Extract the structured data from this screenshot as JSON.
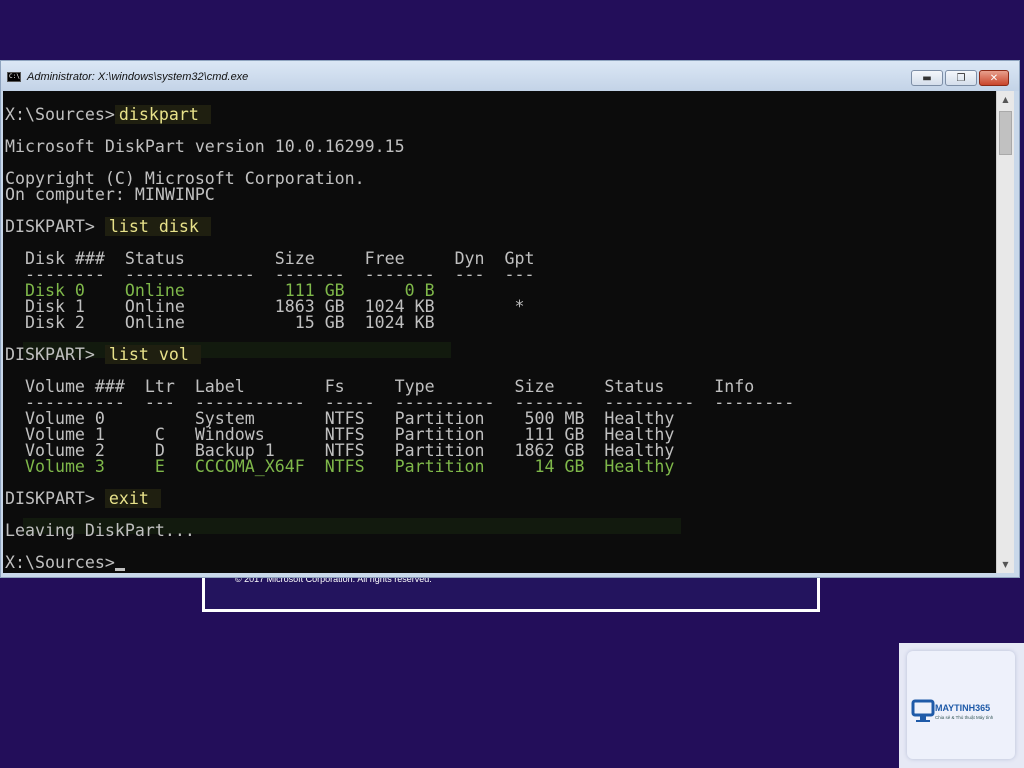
{
  "window": {
    "title": "Administrator: X:\\windows\\system32\\cmd.exe",
    "minimize_icon": "minimize-icon",
    "maximize_icon": "maximize-icon",
    "close_icon": "close-icon"
  },
  "console": {
    "lines": [
      "X:\\Sources>diskpart",
      "",
      "Microsoft DiskPart version 10.0.16299.15",
      "",
      "Copyright (C) Microsoft Corporation.",
      "On computer: MINWINPC",
      "",
      "DISKPART> list disk",
      "",
      "  Disk ###  Status         Size     Free     Dyn  Gpt",
      "  --------  -------------  -------  -------  ---  ---",
      "  Disk 0    Online          111 GB      0 B",
      "  Disk 1    Online         1863 GB  1024 KB        *",
      "  Disk 2    Online           15 GB  1024 KB",
      "",
      "DISKPART> list vol",
      "",
      "  Volume ###  Ltr  Label        Fs     Type        Size     Status     Info",
      "  ----------  ---  -----------  -----  ----------  -------  ---------  --------",
      "  Volume 0         System       NTFS   Partition    500 MB  Healthy",
      "  Volume 1     C   Windows      NTFS   Partition    111 GB  Healthy",
      "  Volume 2     D   Backup 1     NTFS   Partition   1862 GB  Healthy",
      "  Volume 3     E   CCCOMA_X64F  NTFS   Partition     14 GB  Healthy",
      "",
      "DISKPART> exit",
      "",
      "Leaving DiskPart...",
      "",
      "X:\\Sources>"
    ],
    "prompt_sources": "X:\\Sources>",
    "prompt_diskpart": "DISKPART> ",
    "cmd_diskpart": "diskpart",
    "cmd_list_disk": "list disk",
    "cmd_list_vol": "list vol",
    "cmd_exit": "exit"
  },
  "background": {
    "copyright": "© 2017 Microsoft Corporation. All rights reserved."
  },
  "watermark": {
    "name": "MAYTINH365",
    "tagline": "Chia sẻ & Thủ thuật Máy tính"
  },
  "colors": {
    "background": "#230e5a",
    "console_bg": "#0c0c0c",
    "console_text": "#c0c0c0",
    "highlight_green": "#7fb84a",
    "highlight_yellow": "#e8e28a"
  }
}
